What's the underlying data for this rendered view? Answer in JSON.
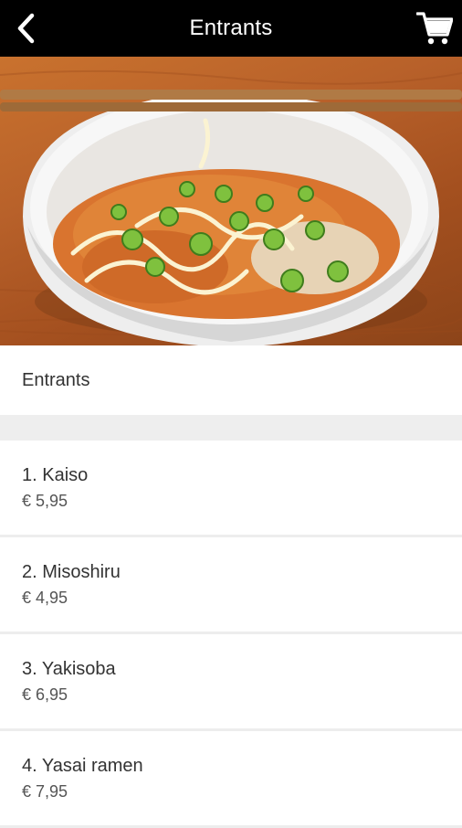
{
  "header": {
    "title": "Entrants"
  },
  "hero": {
    "icon": "food-photo"
  },
  "section": {
    "title": "Entrants"
  },
  "items": [
    {
      "name": "1. Kaiso",
      "price": "€ 5,95"
    },
    {
      "name": "2. Misoshiru",
      "price": "€ 4,95"
    },
    {
      "name": "3. Yakisoba",
      "price": "€ 6,95"
    },
    {
      "name": "4. Yasai ramen",
      "price": "€ 7,95"
    }
  ],
  "colors": {
    "topbar": "#000000",
    "separator": "#eeeeee",
    "text": "#333333"
  }
}
